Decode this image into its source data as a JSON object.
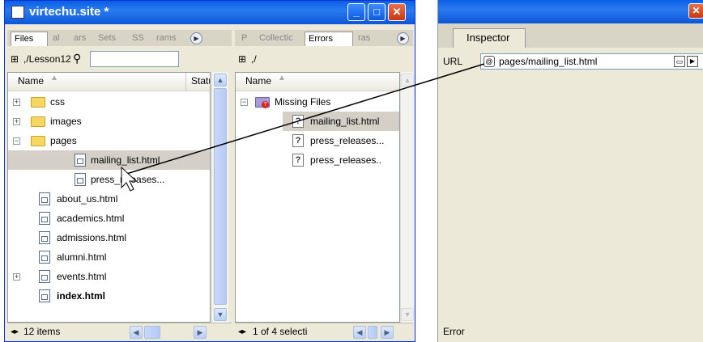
{
  "window": {
    "title": "virtechu.site *",
    "minimize": "_",
    "maximize": "□",
    "close": "✕"
  },
  "left_panel": {
    "tabs": [
      "Files",
      "al",
      "ars",
      "Sets",
      "SS",
      "rams"
    ],
    "path": ",/Lesson12",
    "search_value": "",
    "columns": {
      "name": "Name",
      "status": "Statu"
    },
    "items": [
      {
        "label": "css",
        "type": "folder",
        "expander": "+",
        "indent": 0,
        "bold": false,
        "selected": false
      },
      {
        "label": "images",
        "type": "folder",
        "expander": "+",
        "indent": 0,
        "bold": false,
        "selected": false
      },
      {
        "label": "pages",
        "type": "folder",
        "expander": "−",
        "indent": 0,
        "bold": false,
        "selected": false
      },
      {
        "label": "mailing_list.html",
        "type": "file",
        "expander": "",
        "indent": 1,
        "bold": false,
        "selected": true
      },
      {
        "label": "press_releases...",
        "type": "file",
        "expander": "",
        "indent": 1,
        "bold": false,
        "selected": false
      },
      {
        "label": "about_us.html",
        "type": "file",
        "expander": "",
        "indent": 0,
        "bold": false,
        "selected": false
      },
      {
        "label": "academics.html",
        "type": "file",
        "expander": "",
        "indent": 0,
        "bold": false,
        "selected": false
      },
      {
        "label": "admissions.html",
        "type": "file",
        "expander": "",
        "indent": 0,
        "bold": false,
        "selected": false
      },
      {
        "label": "alumni.html",
        "type": "file",
        "expander": "",
        "indent": 0,
        "bold": false,
        "selected": false
      },
      {
        "label": "events.html",
        "type": "file",
        "expander": "+",
        "indent": 0,
        "bold": false,
        "selected": false
      },
      {
        "label": "index.html",
        "type": "file",
        "expander": "",
        "indent": 0,
        "bold": true,
        "selected": false
      }
    ],
    "status": "12 items"
  },
  "right_panel": {
    "tabs": [
      "P",
      "Collectic",
      "Errors",
      "ras"
    ],
    "path": ",/",
    "columns": {
      "name": "Name"
    },
    "group": {
      "label": "Missing Files",
      "expander": "−"
    },
    "items": [
      {
        "label": "mailing_list.html",
        "selected": true
      },
      {
        "label": "press_releases...",
        "selected": false
      },
      {
        "label": "press_releases..",
        "selected": false
      }
    ],
    "status": "1 of 4 selecti"
  },
  "inspector": {
    "tab": "Inspector",
    "url_label": "URL",
    "url_value": "pages/mailing_list.html",
    "error_label": "Error",
    "close": "✕"
  },
  "colors": {
    "titlebar": "#0a5fe3",
    "selection": "#d4d0c8",
    "frame": "#ece9d8"
  }
}
